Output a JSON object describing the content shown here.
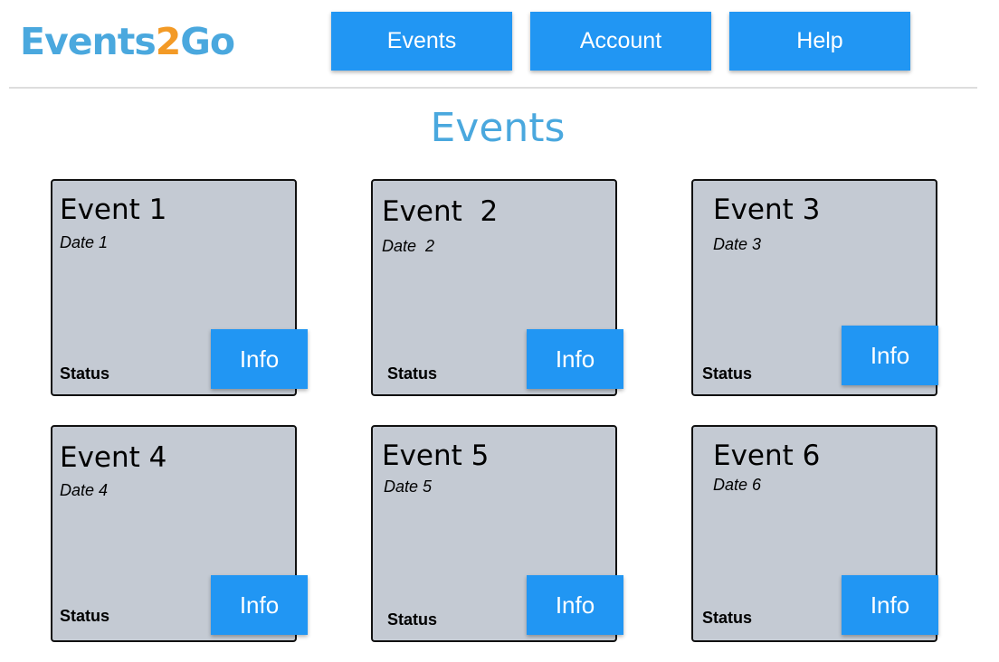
{
  "logo": {
    "part1": "Events",
    "part2": "2",
    "part3": "Go"
  },
  "nav": {
    "events": "Events",
    "account": "Account",
    "help": "Help"
  },
  "page_title": "Events",
  "cards": [
    {
      "title": "Event 1",
      "date": "Date 1",
      "status": "Status",
      "button": "Info"
    },
    {
      "title": "Event  2",
      "date": "Date  2",
      "status": "Status",
      "button": "Info"
    },
    {
      "title": "Event 3",
      "date": "Date 3",
      "status": "Status",
      "button": "Info"
    },
    {
      "title": "Event 4",
      "date": "Date 4",
      "status": "Status",
      "button": "Info"
    },
    {
      "title": "Event 5",
      "date": "Date 5",
      "status": "Status",
      "button": "Info"
    },
    {
      "title": "Event 6",
      "date": "Date 6",
      "status": "Status",
      "button": "Info"
    }
  ],
  "colors": {
    "accent": "#2196f3",
    "brand_blue": "#4aa8de",
    "brand_orange": "#f39a26",
    "card_bg": "#c4cad3"
  }
}
